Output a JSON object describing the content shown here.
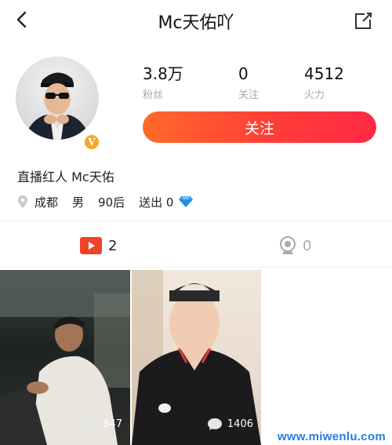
{
  "header": {
    "title": "Mc天佑吖"
  },
  "profile": {
    "badge": "V",
    "stats": [
      {
        "value": "3.8万",
        "label": "粉丝"
      },
      {
        "value": "0",
        "label": "关注"
      },
      {
        "value": "4512",
        "label": "火力"
      }
    ],
    "follow_label": "关注",
    "bio": "直播红人 Mc天佑",
    "location": "成都",
    "gender": "男",
    "age_group": "90后",
    "gifts_sent": "送出 0"
  },
  "tabs": [
    {
      "icon": "video-play-icon",
      "count": "2"
    },
    {
      "icon": "live-camera-icon",
      "count": "0"
    }
  ],
  "videos": [
    {
      "views": "847"
    },
    {
      "views": "1406"
    }
  ],
  "watermark": "www.miwenlu.com",
  "colors": {
    "accent": "#ff3d37",
    "video_icon": "#f0432c",
    "diamond": "#3fa9f5",
    "badge": "#f5a623"
  }
}
